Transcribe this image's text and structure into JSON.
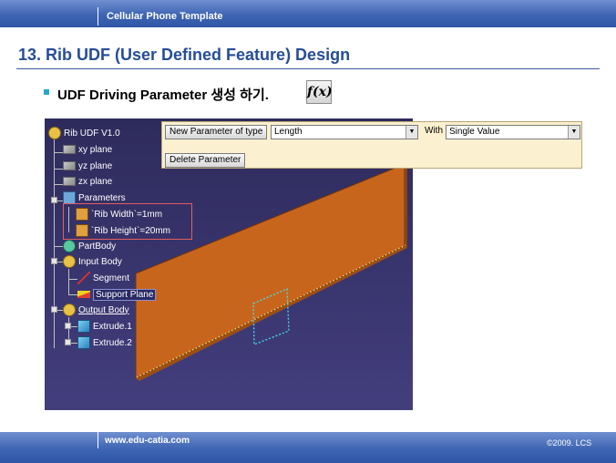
{
  "header": {
    "template_title": "Cellular Phone Template"
  },
  "slide": {
    "title": "13. Rib UDF (User Defined Feature) Design",
    "bullet_text": "UDF Driving Parameter 생성 하기.",
    "fx_button_label": "f(x)"
  },
  "tree": {
    "root": "Rib UDF V1.0",
    "planes": [
      "xy plane",
      "yz plane",
      "zx plane"
    ],
    "parameters_label": "Parameters",
    "parameters": [
      "`Rib Width`=1mm",
      "`Rib Height`=20mm"
    ],
    "partbody": "PartBody",
    "input_body": "Input Body",
    "inputs": [
      "Segment",
      "Support Plane"
    ],
    "output_body": "Output Body",
    "outputs": [
      "Extrude.1",
      "Extrude.2"
    ]
  },
  "dialog": {
    "new_param_button": "New Parameter of type",
    "type_value": "Length",
    "with_label": "With",
    "with_value": "Single Value",
    "delete_button": "Delete Parameter"
  },
  "footer": {
    "url": "www.edu-catia.com",
    "copyright": "©2009. LCS"
  },
  "colors": {
    "title_blue": "#274d97",
    "rib_orange": "#c8651d",
    "viewport_bg": "#3a3670",
    "dialog_bg": "#fbf0cf"
  }
}
